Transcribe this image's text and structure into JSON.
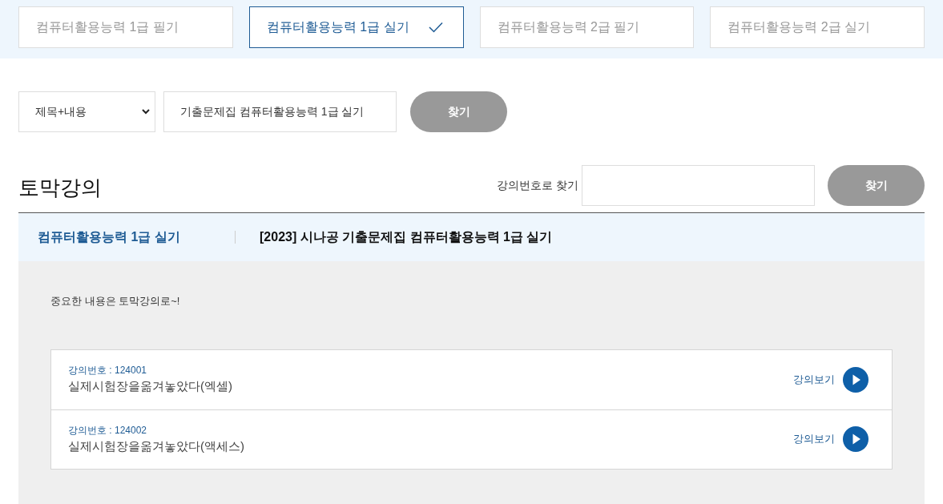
{
  "tabs": [
    {
      "label": "컴퓨터활용능력 1급 필기",
      "selected": false
    },
    {
      "label": "컴퓨터활용능력 1급 실기",
      "selected": true
    },
    {
      "label": "컴퓨터활용능력 2급 필기",
      "selected": false
    },
    {
      "label": "컴퓨터활용능력 2급 실기",
      "selected": false
    }
  ],
  "search": {
    "scope": "제목+내용",
    "query": "기출문제집 컴퓨터활용능력 1급 실기",
    "button": "찾기"
  },
  "section": {
    "title": "토막강의",
    "number_search": {
      "label": "강의번호로 찾기",
      "button": "찾기"
    }
  },
  "category": {
    "name": "컴퓨터활용능력 1급 실기",
    "book": "[2023] 시나공 기출문제집 컴퓨터활용능력 1급 실기"
  },
  "intro": "중요한 내용은 토막강의로~!",
  "lectures": [
    {
      "number": "강의번호 : 124001",
      "title": "실제시험장을옮겨놓았다(엑셀)",
      "action": "강의보기"
    },
    {
      "number": "강의번호 : 124002",
      "title": "실제시험장을옮겨놓았다(액세스)",
      "action": "강의보기"
    }
  ]
}
